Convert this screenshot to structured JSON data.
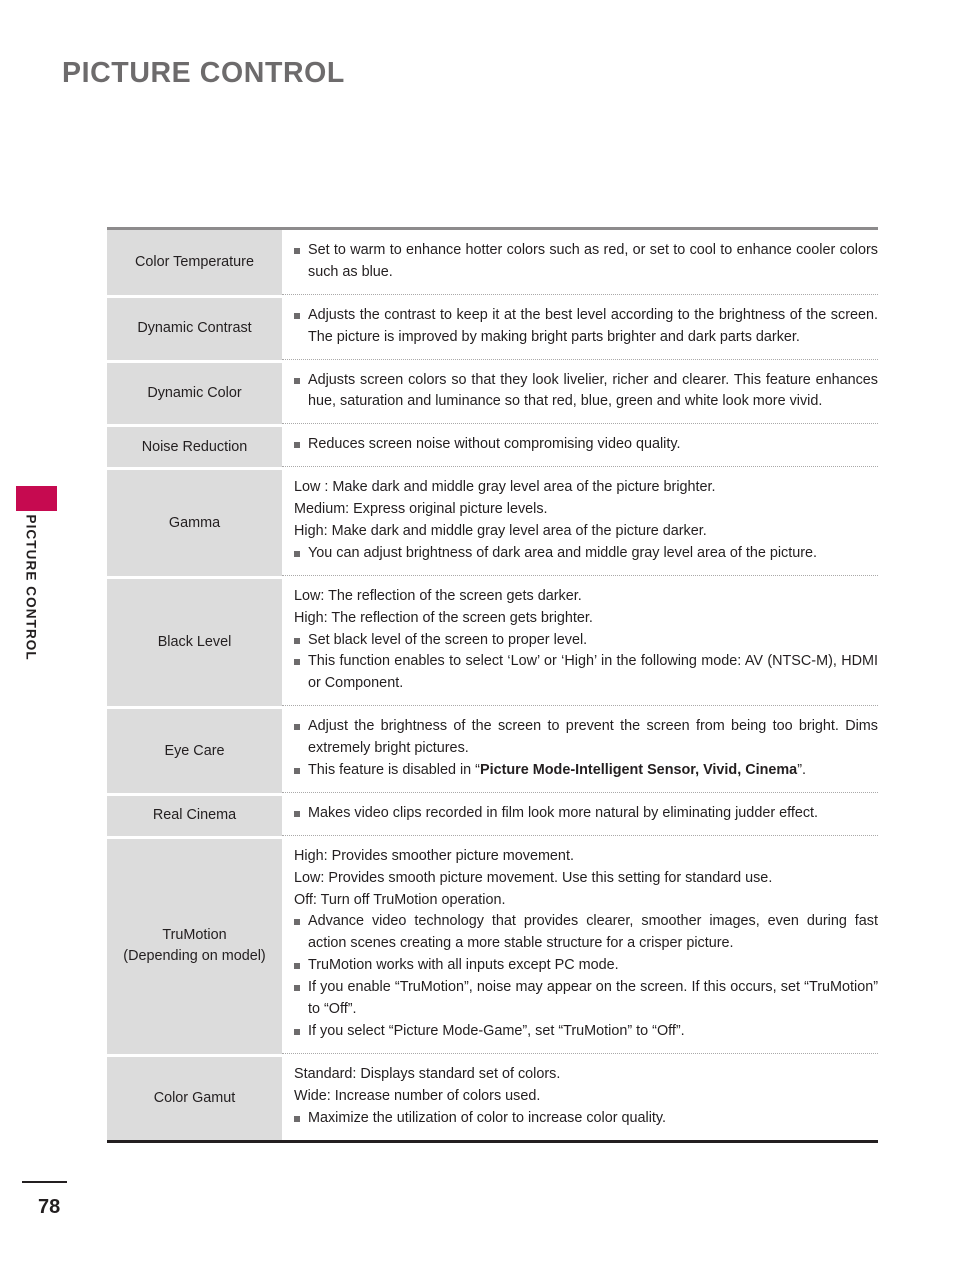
{
  "page": {
    "heading": "PICTURE CONTROL",
    "side_label": "PICTURE CONTROL",
    "number": "78",
    "tab_color": "#c60a50",
    "heading_color": "#6d6b6c",
    "label_cell_bg": "#dcdcdc"
  },
  "table": {
    "rows": [
      {
        "label": "Color Temperature",
        "label_sub": "",
        "lines": [
          {
            "type": "bullet",
            "text": "Set to warm to enhance hotter colors such as red, or set to cool to enhance cooler colors such as blue."
          }
        ]
      },
      {
        "label": "Dynamic Contrast",
        "label_sub": "",
        "lines": [
          {
            "type": "bullet",
            "text": "Adjusts the contrast to keep it at the best level according to the brightness of the screen. The picture is improved by making bright parts brighter and dark parts darker."
          }
        ]
      },
      {
        "label": "Dynamic Color",
        "label_sub": "",
        "lines": [
          {
            "type": "bullet",
            "text": "Adjusts screen colors so that they look livelier, richer and clearer. This feature enhances hue, saturation and luminance so that red, blue, green and white look more vivid."
          }
        ]
      },
      {
        "label": "Noise Reduction",
        "label_sub": "",
        "lines": [
          {
            "type": "bullet",
            "text": "Reduces screen noise without compromising video quality."
          }
        ]
      },
      {
        "label": "Gamma",
        "label_sub": "",
        "lines": [
          {
            "type": "plain",
            "text": "Low : Make dark and middle gray level area of the picture brighter."
          },
          {
            "type": "plain",
            "text": "Medium: Express original picture levels."
          },
          {
            "type": "plain",
            "text": "High: Make dark and middle gray level area of the picture darker."
          },
          {
            "type": "bullet",
            "text": "You can adjust brightness of dark area and middle gray level area of the picture."
          }
        ]
      },
      {
        "label": "Black Level",
        "label_sub": "",
        "lines": [
          {
            "type": "plain",
            "text": "Low: The reflection of the screen gets darker."
          },
          {
            "type": "plain",
            "text": "High: The reflection of the screen gets brighter."
          },
          {
            "type": "bullet",
            "text": "Set black level of the screen to proper level."
          },
          {
            "type": "bullet",
            "text": "This function enables to select ‘Low’ or ‘High’ in the following mode: AV (NTSC-M), HDMI or Component."
          }
        ]
      },
      {
        "label": "Eye Care",
        "label_sub": "",
        "lines": [
          {
            "type": "bullet",
            "text": "Adjust the brightness of the screen to prevent the screen from being too bright. Dims extremely bright pictures."
          },
          {
            "type": "bullet-rich",
            "text_before": "This feature is disabled in “",
            "text_bold": "Picture Mode-Intelligent Sensor, Vivid, Cinema",
            "text_after": "”."
          }
        ]
      },
      {
        "label": "Real Cinema",
        "label_sub": "",
        "lines": [
          {
            "type": "bullet",
            "text": "Makes video clips recorded in film look more natural by eliminating judder effect."
          }
        ]
      },
      {
        "label": "TruMotion",
        "label_sub": "(Depending on model)",
        "lines": [
          {
            "type": "plain",
            "text": "High: Provides smoother picture movement."
          },
          {
            "type": "plain",
            "text": "Low: Provides smooth picture movement. Use this setting for standard use."
          },
          {
            "type": "plain",
            "text": "Off: Turn off TruMotion operation."
          },
          {
            "type": "bullet",
            "text": "Advance video technology that provides clearer, smoother images, even during fast action scenes creating a more stable structure for a crisper picture."
          },
          {
            "type": "bullet",
            "text": "TruMotion works with all inputs except PC mode."
          },
          {
            "type": "bullet",
            "text": "If you enable “TruMotion”, noise may appear on the screen. If this occurs, set “TruMotion” to “Off”."
          },
          {
            "type": "bullet",
            "text": "If you select “Picture Mode-Game”, set “TruMotion” to “Off”."
          }
        ]
      },
      {
        "label": "Color Gamut",
        "label_sub": "",
        "lines": [
          {
            "type": "plain",
            "text": "Standard: Displays standard set of colors."
          },
          {
            "type": "plain",
            "text": "Wide: Increase number of colors used."
          },
          {
            "type": "bullet",
            "text": "Maximize the utilization of color to increase color quality."
          }
        ]
      }
    ]
  }
}
